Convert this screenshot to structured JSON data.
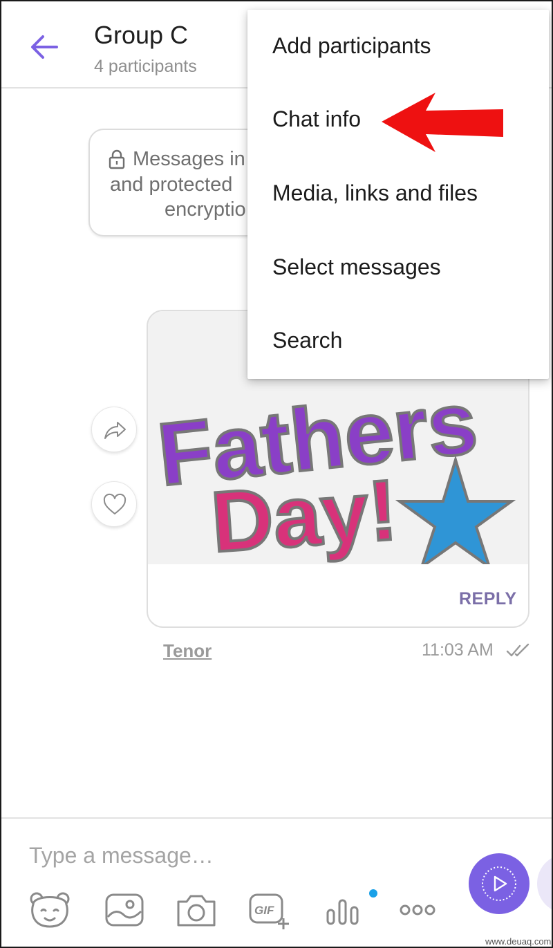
{
  "header": {
    "title": "Group C",
    "subtitle": "4 participants"
  },
  "notice": {
    "line1": "Messages in",
    "line2": "and protected",
    "line3": "encryptio"
  },
  "message": {
    "image_text_line1": "Fathers",
    "image_text_line2": "Day!",
    "reply_label": "REPLY",
    "source_link": "Tenor",
    "time": "11:03 AM"
  },
  "menu": {
    "items": [
      {
        "label": "Add participants"
      },
      {
        "label": "Chat info"
      },
      {
        "label": "Media, links and files"
      },
      {
        "label": "Select messages"
      },
      {
        "label": "Search"
      }
    ]
  },
  "composer": {
    "placeholder": "Type a message…"
  },
  "watermark": "www.deuaq.com",
  "colors": {
    "accent": "#7b61e3",
    "back_arrow": "#7b61e3",
    "annotation_arrow": "#ee1111",
    "reply": "#7b6fa8",
    "badge": "#1aa1e8"
  },
  "icons": {
    "back": "arrow-left-icon",
    "lock": "lock-icon",
    "share": "share-arrow-icon",
    "like": "heart-icon",
    "read": "double-check-icon",
    "send": "send-play-icon",
    "stickers": "bear-face-icon",
    "gallery": "image-icon",
    "camera": "camera-icon",
    "gif": "gif-plus-icon",
    "voice": "voice-bars-icon",
    "more": "more-dots-icon"
  }
}
